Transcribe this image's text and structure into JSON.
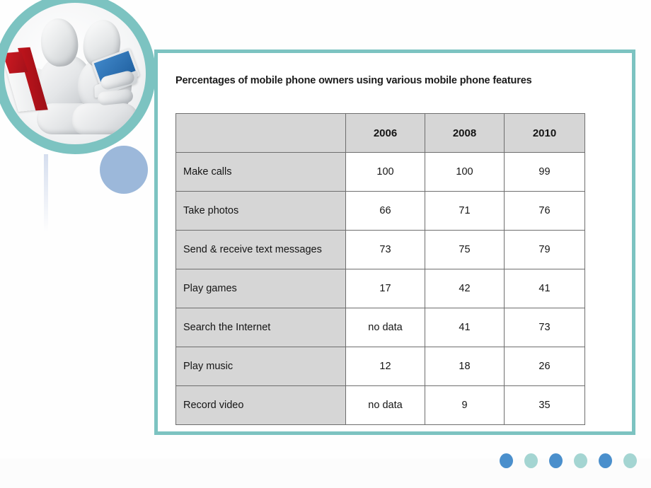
{
  "slide": {
    "title": "Percentages of mobile phone owners using various mobile phone features"
  },
  "illustration": {
    "name": "two-figures-reading-and-laptop",
    "ring_color": "#7CC3C1",
    "book_color": "#B5131C",
    "laptop_color": "#2E76BB",
    "overlay_circle_color": "#608CC4"
  },
  "frame": {
    "border_color": "#7CC3C1"
  },
  "table": {
    "header": [
      "",
      "2006",
      "2008",
      "2010"
    ],
    "header_bg": "#D6D6D6",
    "label_bg": "#D6D6D6",
    "value_bg": "#FFFFFF",
    "border_color": "#6E6E6E",
    "rows": [
      {
        "label": "Make calls",
        "values": [
          "100",
          "100",
          "99"
        ]
      },
      {
        "label": "Take photos",
        "values": [
          "66",
          "71",
          "76"
        ]
      },
      {
        "label": "Send & receive text messages",
        "values": [
          "73",
          "75",
          "79"
        ]
      },
      {
        "label": "Play games",
        "values": [
          "17",
          "42",
          "41"
        ]
      },
      {
        "label": "Search the Internet",
        "values": [
          "no data",
          "41",
          "73"
        ]
      },
      {
        "label": "Play music",
        "values": [
          "12",
          "18",
          "26"
        ]
      },
      {
        "label": "Record video",
        "values": [
          "no data",
          "9",
          "35"
        ]
      }
    ]
  },
  "decorations": {
    "dots": [
      {
        "color": "#4A8FCC",
        "variant": "blue"
      },
      {
        "color": "#A4D5D2",
        "variant": "teal"
      },
      {
        "color": "#4A8FCC",
        "variant": "blue"
      },
      {
        "color": "#A4D5D2",
        "variant": "teal"
      },
      {
        "color": "#4A8FCC",
        "variant": "blue"
      },
      {
        "color": "#A4D5D2",
        "variant": "teal"
      }
    ]
  }
}
